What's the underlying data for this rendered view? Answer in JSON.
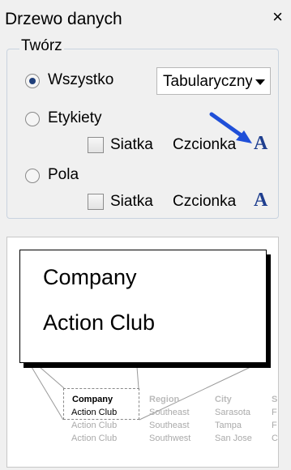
{
  "panel": {
    "title": "Drzewo danych",
    "close_glyph": "×"
  },
  "group": {
    "legend": "Twórz",
    "options": [
      {
        "label": "Wszystko",
        "selected": true
      },
      {
        "label": "Etykiety",
        "selected": false
      },
      {
        "label": "Pola",
        "selected": false
      }
    ],
    "format_select": {
      "value": "Tabularyczny"
    },
    "labels_row": {
      "grid_label": "Siatka",
      "grid_checked": false,
      "font_label": "Czcionka",
      "font_icon": "A"
    },
    "fields_row": {
      "grid_label": "Siatka",
      "grid_checked": false,
      "font_label": "Czcionka",
      "font_icon": "A"
    }
  },
  "preview": {
    "zoom_lines": [
      "Company",
      "Action Club"
    ],
    "table_headers": [
      "Company",
      "Region",
      "City",
      "S"
    ],
    "rows": [
      [
        "Action Club",
        "Southeast",
        "Sarasota",
        "F"
      ],
      [
        "Action Club",
        "Southeast",
        "Tampa",
        "F"
      ],
      [
        "Action Club",
        "Southwest",
        "San Jose",
        "C"
      ]
    ]
  },
  "colors": {
    "accent_blue": "#1f4fd8",
    "font_icon": "#1f3f8f"
  }
}
